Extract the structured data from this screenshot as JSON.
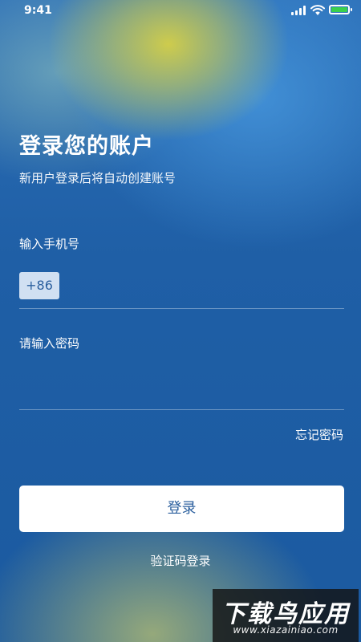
{
  "status_bar": {
    "time": "9:41",
    "icons": [
      "signal-icon",
      "wifi-icon",
      "battery-icon"
    ],
    "battery_color": "#3ad14c"
  },
  "header": {
    "title": "登录您的账户",
    "subtitle": "新用户登录后将自动创建账号"
  },
  "phone": {
    "label": "输入手机号",
    "country_code": "+86",
    "value": ""
  },
  "password": {
    "label": "请输入密码",
    "value": ""
  },
  "actions": {
    "forgot": "忘记密码",
    "login": "登录",
    "code_login": "验证码登录"
  },
  "watermark": {
    "title": "下载鸟应用",
    "url": "www.xiazainiao.com"
  },
  "colors": {
    "background": "#1f5ea6",
    "button_text": "#2b5f9e",
    "button_bg": "#ffffff"
  }
}
